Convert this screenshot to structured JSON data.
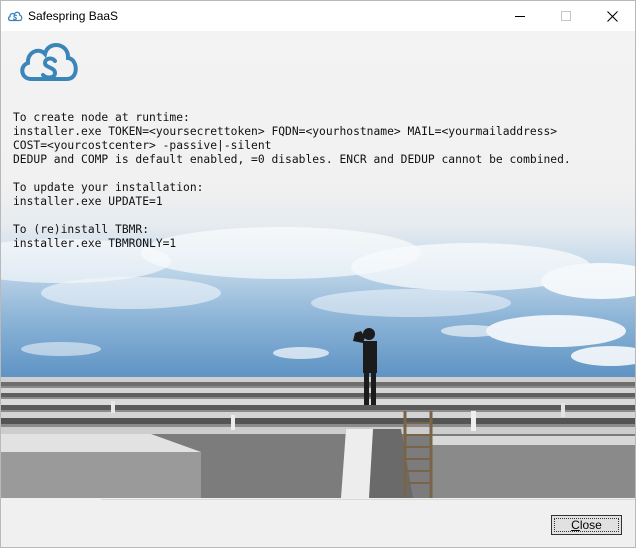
{
  "window": {
    "title": "Safespring BaaS",
    "minimize_glyph": "—",
    "maximize_glyph": "☐",
    "close_glyph": "✕"
  },
  "brand": {
    "logo_icon": "cloud-s-icon",
    "accent_color": "#3b86b9"
  },
  "instructions": {
    "runtime_heading": "To create node at runtime:",
    "runtime_line1": "installer.exe TOKEN=<yoursecrettoken> FQDN=<yourhostname> MAIL=<yourmailaddress>",
    "runtime_line2": "COST=<yourcostcenter> -passive|-silent",
    "runtime_line3": "DEDUP and COMP is default enabled, =0 disables. ENCR and DEDUP cannot be combined.",
    "update_heading": "To update your installation:",
    "update_line": "installer.exe UPDATE=1",
    "reinstall_heading": "To (re)install TBMR:",
    "reinstall_line": "installer.exe TBMRONLY=1"
  },
  "footer": {
    "close_button_accel": "C",
    "close_button_rest": "lose"
  }
}
